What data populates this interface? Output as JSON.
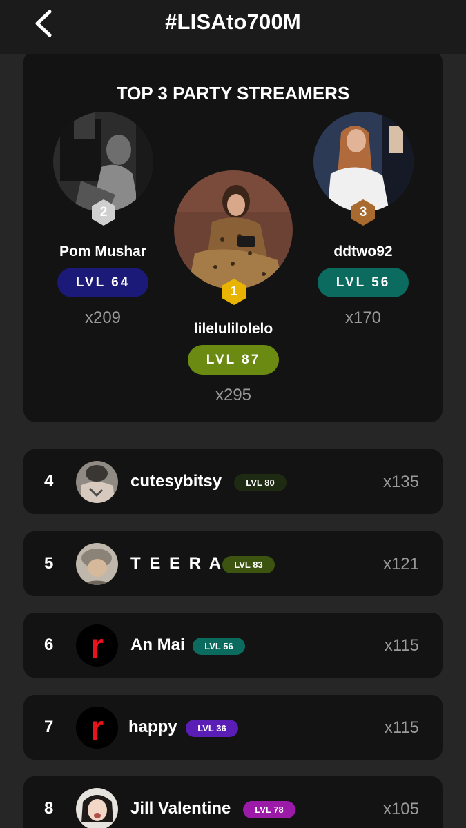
{
  "header": {
    "title": "#LISAto700M",
    "back_icon": "chevron-left-icon"
  },
  "top3": {
    "title": "TOP 3 PARTY STREAMERS",
    "podium": [
      {
        "rank": "1",
        "name": "lilelulilolelo",
        "level": "LVL 87",
        "count": "x295",
        "level_color": "#6a8a12",
        "badge_color": "#e8b400"
      },
      {
        "rank": "2",
        "name": "Pom Mushar",
        "level": "LVL 64",
        "count": "x209",
        "level_color": "#1b1a78",
        "badge_color": "#cfcfcf"
      },
      {
        "rank": "3",
        "name": "ddtwo92",
        "level": "LVL 56",
        "count": "x170",
        "level_color": "#0b6b5e",
        "badge_color": "#a86a2e"
      }
    ]
  },
  "rows": [
    {
      "rank": "4",
      "name": "cutesybitsy",
      "level": "LVL 80",
      "count": "x135",
      "level_color": "#1f2a12"
    },
    {
      "rank": "5",
      "name": "T E E R A K",
      "level": "LVL 83",
      "count": "x121",
      "level_color": "#3d5410"
    },
    {
      "rank": "6",
      "name": "An Mai",
      "level": "LVL 56",
      "count": "x115",
      "level_color": "#0b6b5e",
      "avatar_letter": "r"
    },
    {
      "rank": "7",
      "name": "happy",
      "level": "LVL 36",
      "count": "x115",
      "level_color": "#5a1db5",
      "avatar_letter": "r"
    },
    {
      "rank": "8",
      "name": "Jill Valentine",
      "level": "LVL 78",
      "count": "x105",
      "level_color": "#9b1aa8"
    }
  ],
  "colors": {
    "background": "#262626",
    "card": "#131313",
    "header": "#1b1b1b",
    "muted_text": "#9a9a9a",
    "avatar_letter_red": "#e8141c"
  }
}
